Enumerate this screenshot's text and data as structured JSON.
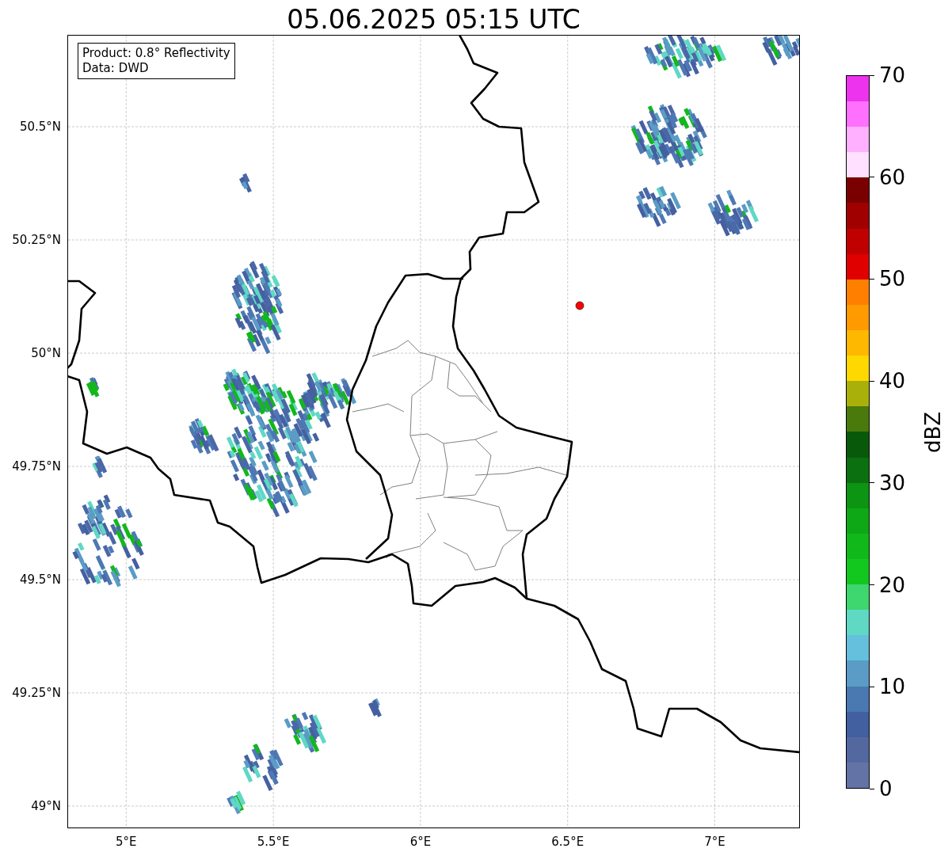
{
  "title": "05.06.2025 05:15 UTC",
  "legend": [
    "Product: 0.8° Reflectivity",
    "Data: DWD"
  ],
  "map": {
    "x_tick_labels": [
      "5°E",
      "5.5°E",
      "6°E",
      "6.5°E",
      "7°E"
    ],
    "y_tick_labels": [
      "50.5°N",
      "50.25°N",
      "50°N",
      "49.75°N",
      "49.5°N",
      "49.25°N",
      "49°N"
    ]
  },
  "colorbar": {
    "label": "dBZ",
    "tick_labels": [
      "70",
      "60",
      "50",
      "40",
      "30",
      "20",
      "10",
      "0"
    ],
    "bands": [
      {
        "color": "#6473a5"
      },
      {
        "color": "#5468a0"
      },
      {
        "color": "#425fa0"
      },
      {
        "color": "#4a78b0"
      },
      {
        "color": "#5a9cc5"
      },
      {
        "color": "#64c0dc"
      },
      {
        "color": "#5fd8c4"
      },
      {
        "color": "#3ed66e"
      },
      {
        "color": "#12c81e"
      },
      {
        "color": "#10b81a"
      },
      {
        "color": "#0ea816"
      },
      {
        "color": "#0c9412"
      },
      {
        "color": "#0a7010"
      },
      {
        "color": "#085a0a"
      },
      {
        "color": "#4a7a0c"
      },
      {
        "color": "#aab00a"
      },
      {
        "color": "#ffd800"
      },
      {
        "color": "#ffb800"
      },
      {
        "color": "#ff9a00"
      },
      {
        "color": "#ff8000"
      },
      {
        "color": "#e00000"
      },
      {
        "color": "#c00000"
      },
      {
        "color": "#a00000"
      },
      {
        "color": "#7a0000"
      },
      {
        "color": "#ffe0ff"
      },
      {
        "color": "#ffb0ff"
      },
      {
        "color": "#ff70ff"
      },
      {
        "color": "#ee33ee"
      }
    ]
  }
}
